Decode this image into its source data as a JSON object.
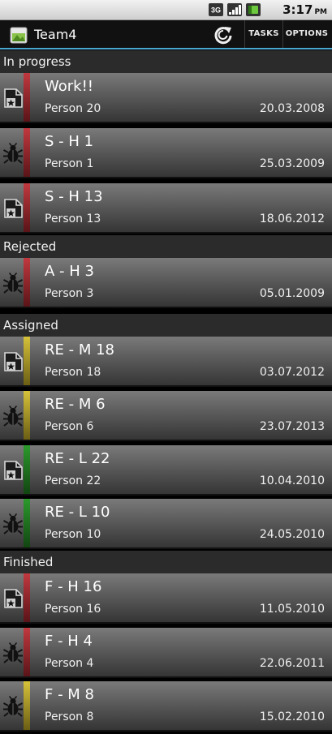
{
  "status_bar": {
    "time": "3:17",
    "ampm": "PM",
    "network": "3G"
  },
  "action_bar": {
    "title": "Team4",
    "tasks_label": "TASKS",
    "options_label": "OPTIONS"
  },
  "colors": {
    "red": "#c0393f",
    "yellow": "#d6c23a",
    "green": "#2c9a2c",
    "accent": "#4aa7d0"
  },
  "sections": {
    "in_progress": "In progress",
    "rejected": "Rejected",
    "assigned": "Assigned",
    "finished": "Finished"
  },
  "tasks": [
    {
      "title": "Work!!",
      "person": "Person 20",
      "date": "20.03.2008",
      "type": "task-icon",
      "priority": "red"
    },
    {
      "title": "S - H 1",
      "person": "Person 1",
      "date": "25.03.2009",
      "type": "bug-icon",
      "priority": "red"
    },
    {
      "title": "S - H 13",
      "person": "Person 13",
      "date": "18.06.2012",
      "type": "task-icon",
      "priority": "red"
    },
    {
      "title": "A - H 3",
      "person": "Person 3",
      "date": "05.01.2009",
      "type": "bug-icon",
      "priority": "red"
    },
    {
      "title": "RE - M 18",
      "person": "Person 18",
      "date": "03.07.2012",
      "type": "task-icon",
      "priority": "yellow"
    },
    {
      "title": "RE - M 6",
      "person": "Person 6",
      "date": "23.07.2013",
      "type": "bug-icon",
      "priority": "yellow"
    },
    {
      "title": "RE - L 22",
      "person": "Person 22",
      "date": "10.04.2010",
      "type": "task-icon",
      "priority": "green"
    },
    {
      "title": "RE - L 10",
      "person": "Person 10",
      "date": "24.05.2010",
      "type": "bug-icon",
      "priority": "green"
    },
    {
      "title": "F - H 16",
      "person": "Person 16",
      "date": "11.05.2010",
      "type": "task-icon",
      "priority": "red"
    },
    {
      "title": "F - H 4",
      "person": "Person 4",
      "date": "22.06.2011",
      "type": "bug-icon",
      "priority": "red"
    },
    {
      "title": "F - M 8",
      "person": "Person 8",
      "date": "15.02.2010",
      "type": "bug-icon",
      "priority": "yellow"
    }
  ]
}
